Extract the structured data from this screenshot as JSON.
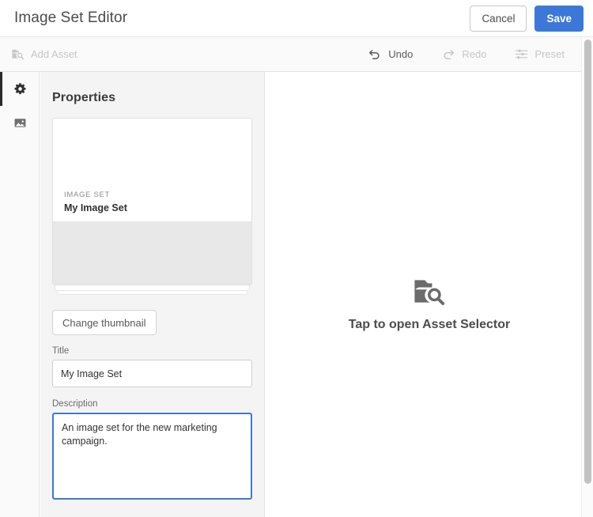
{
  "header": {
    "title": "Image Set Editor",
    "cancel_label": "Cancel",
    "save_label": "Save",
    "save_color": "#3c78d8"
  },
  "toolbar": {
    "add_asset": {
      "label": "Add Asset",
      "icon": "folder-search-icon",
      "state": "disabled"
    },
    "undo": {
      "label": "Undo",
      "icon": "undo-arrow-icon",
      "state": "enabled"
    },
    "redo": {
      "label": "Redo",
      "icon": "redo-arrow-icon",
      "state": "disabled"
    },
    "preset": {
      "label": "Preset",
      "icon": "sliders-icon",
      "state": "disabled"
    }
  },
  "rail": {
    "items": [
      {
        "name": "properties",
        "icon": "gear-icon",
        "active": true
      },
      {
        "name": "assets",
        "icon": "image-icon",
        "active": false
      }
    ]
  },
  "properties": {
    "title": "Properties",
    "card": {
      "kicker": "IMAGE SET",
      "name": "My Image Set"
    },
    "change_thumbnail_label": "Change thumbnail",
    "title_field": {
      "label": "Title",
      "value": "My Image Set",
      "placeholder": "Title"
    },
    "description_field": {
      "label": "Description",
      "value": "An image set for the new marketing campaign.",
      "placeholder": "Description",
      "focused": true
    }
  },
  "canvas": {
    "empty_state": {
      "icon": "folder-search-icon",
      "label": "Tap to open Asset Selector"
    }
  }
}
